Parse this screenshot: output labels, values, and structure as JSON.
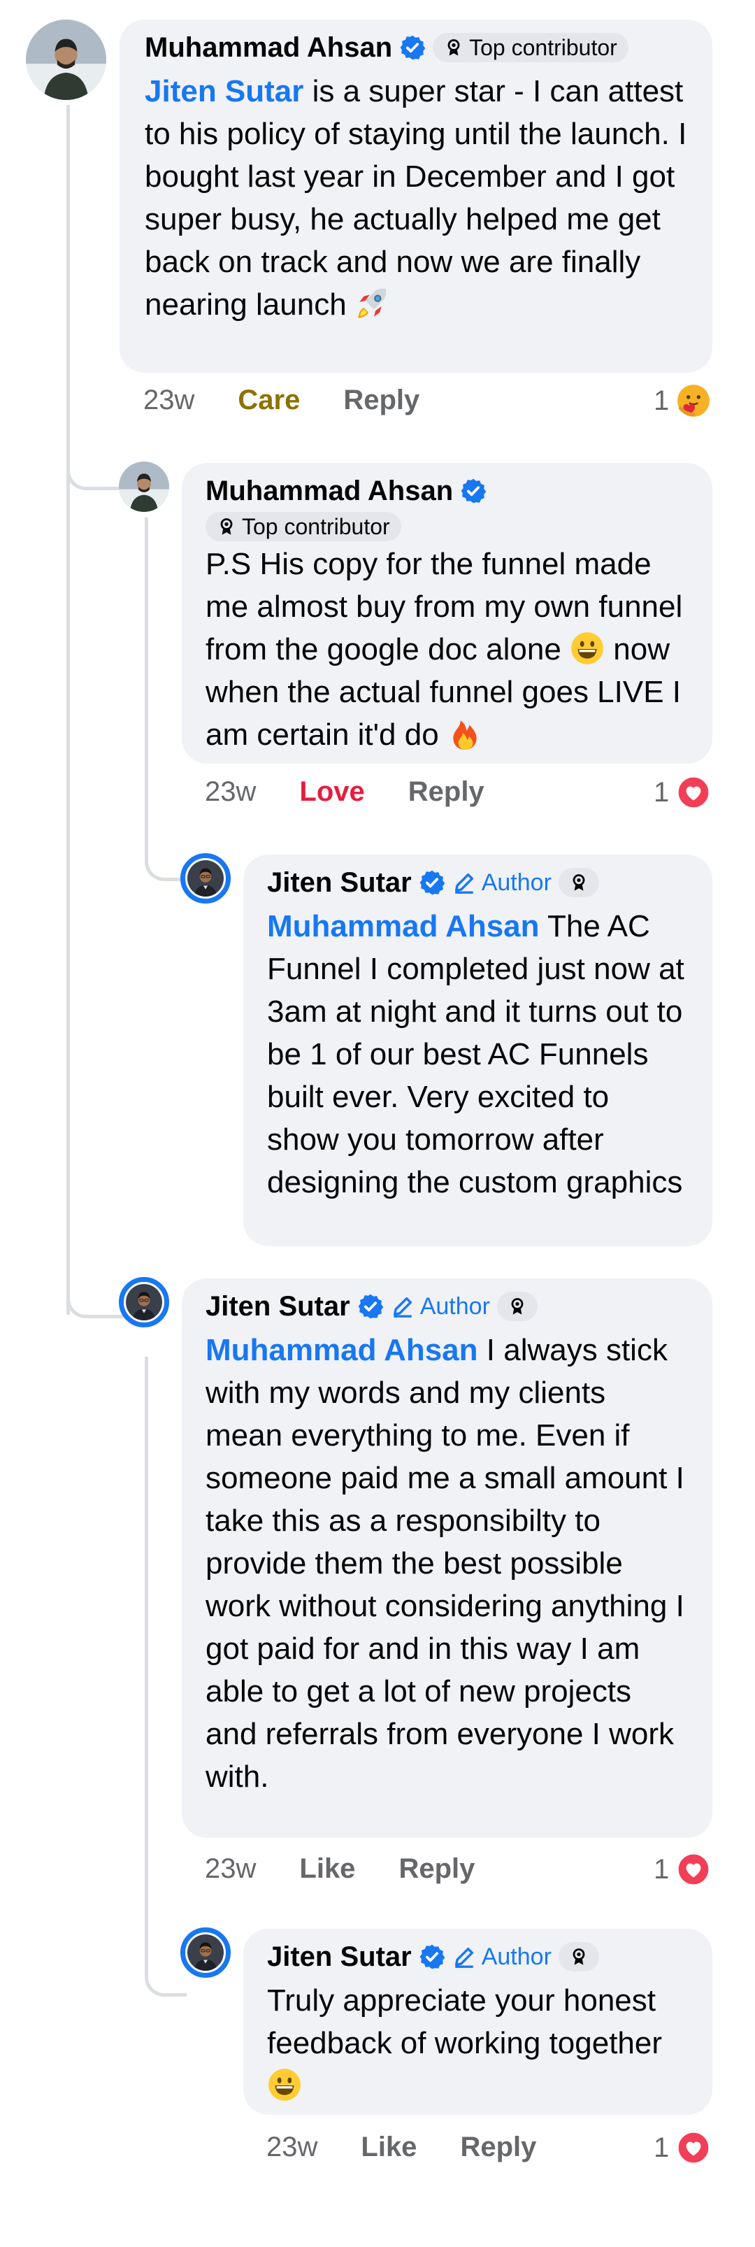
{
  "comments": [
    {
      "name": "Muhammad Ahsan",
      "badge": "Top contributor",
      "mention": "Jiten Sutar",
      "text": " is a super star - I can attest to his policy of staying until the launch. I bought last year in December and I got super busy, he actually helped me get back on track and now we are finally nearing launch",
      "emoji": "rocket-emoji",
      "time": "23w",
      "reaction": "Care",
      "reaction_color": "#8c7200",
      "reply": "Reply",
      "count": "1",
      "count_icon": "care-icon"
    },
    {
      "name": "Muhammad Ahsan",
      "badge": "Top contributor",
      "text_a": "P.S His copy for the funnel made me almost buy from my own funnel from the google doc alone",
      "emoji_a": "grinning-emoji",
      "text_b": " now when the actual funnel goes LIVE I am certain it'd do",
      "emoji_b": "fire-emoji",
      "time": "23w",
      "reaction": "Love",
      "reaction_color": "#e41e3f",
      "reply": "Reply",
      "count": "1",
      "count_icon": "love-icon"
    },
    {
      "name": "Jiten Sutar",
      "author": "Author",
      "mention": "Muhammad Ahsan",
      "text": " The AC Funnel I completed just now at 3am at night and it turns out to be 1 of our best AC Funnels built ever. Very excited to show you tomorrow after designing the custom graphics"
    },
    {
      "name": "Jiten Sutar",
      "author": "Author",
      "mention": "Muhammad Ahsan",
      "text": " I always stick with my words and my clients mean everything to me. Even if someone paid me a small amount I take this as a responsibilty to provide them the best possible work without considering anything I got paid for and in this way I am able to get a lot of new projects and referrals from everyone I work with.",
      "time": "23w",
      "like": "Like",
      "reply": "Reply",
      "count": "1",
      "count_icon": "love-icon"
    },
    {
      "name": "Jiten Sutar",
      "author": "Author",
      "text": "Truly appreciate your honest feedback of working together",
      "emoji": "grinning-emoji",
      "time": "23w",
      "like": "Like",
      "reply": "Reply",
      "count": "1",
      "count_icon": "love-icon"
    }
  ],
  "colors": {
    "accent": "#1877f2",
    "bubble": "#f0f2f5",
    "secondary_text": "#65676b",
    "love": "#e41e3f",
    "care": "#8c7200"
  }
}
